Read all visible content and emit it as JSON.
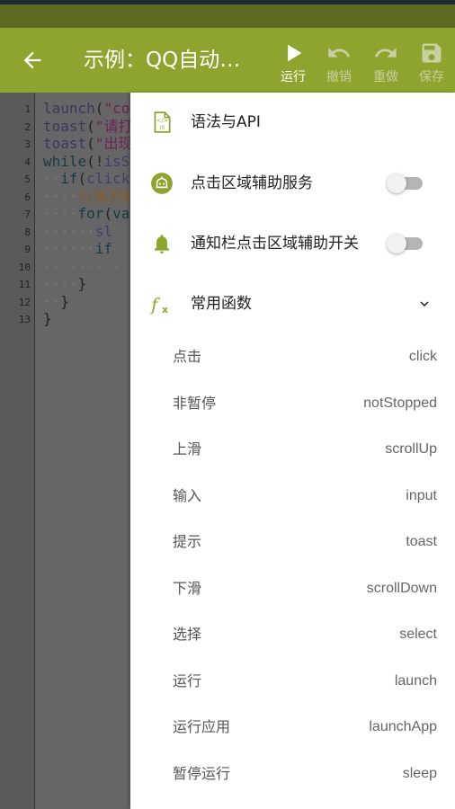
{
  "colors": {
    "appbar": "#8da52e",
    "accent": "#8da52e",
    "statusbar": "#5e6b22"
  },
  "appbar": {
    "back_icon": "arrow-left-icon",
    "title": "示例：QQ自动…",
    "actions": [
      {
        "label": "运行",
        "icon": "play-icon",
        "enabled": true
      },
      {
        "label": "撤销",
        "icon": "undo-icon",
        "enabled": false
      },
      {
        "label": "重做",
        "icon": "redo-icon",
        "enabled": false
      },
      {
        "label": "保存",
        "icon": "save-icon",
        "enabled": false
      }
    ]
  },
  "editor": {
    "line_numbers": [
      "1",
      "2",
      "3",
      "4",
      "5",
      "6",
      "7",
      "8",
      "9",
      "10",
      "11",
      "12",
      "13"
    ],
    "lines": [
      {
        "indent": "",
        "parts": [
          [
            "fn",
            "launch"
          ],
          [
            "p",
            "("
          ],
          [
            "str",
            "\"co"
          ]
        ]
      },
      {
        "indent": "",
        "parts": [
          [
            "fn",
            "toast"
          ],
          [
            "p",
            "("
          ],
          [
            "str",
            "\"请打"
          ]
        ]
      },
      {
        "indent": "",
        "parts": [
          [
            "fn",
            "toast"
          ],
          [
            "p",
            "("
          ],
          [
            "str",
            "\"出现"
          ]
        ]
      },
      {
        "indent": "",
        "parts": [
          [
            "kw",
            "while"
          ],
          [
            "p",
            "(!"
          ],
          [
            "id",
            "isS"
          ]
        ]
      },
      {
        "indent": "··",
        "parts": [
          [
            "kw",
            "if"
          ],
          [
            "p",
            "("
          ],
          [
            "id",
            "click"
          ]
        ]
      },
      {
        "indent": "····",
        "parts": [
          [
            "cm",
            "//拆开红"
          ]
        ]
      },
      {
        "indent": "····",
        "parts": [
          [
            "kw",
            "for"
          ],
          [
            "p",
            "("
          ],
          [
            "kw",
            "va"
          ]
        ]
      },
      {
        "indent": "······",
        "parts": [
          [
            "id",
            "sl"
          ]
        ]
      },
      {
        "indent": "······",
        "parts": [
          [
            "kw",
            "if"
          ]
        ]
      },
      {
        "indent": "·········",
        "parts": []
      },
      {
        "indent": "····",
        "parts": [
          [
            "p",
            "}"
          ]
        ]
      },
      {
        "indent": "··",
        "parts": [
          [
            "p",
            "}"
          ]
        ]
      },
      {
        "indent": "",
        "parts": [
          [
            "p",
            "}"
          ]
        ]
      }
    ]
  },
  "drawer": {
    "items": [
      {
        "label": "语法与API",
        "icon": "js-file-icon"
      },
      {
        "label": "点击区域辅助服务",
        "icon": "robot-icon",
        "toggle": false
      },
      {
        "label": "通知栏点击区域辅助开关",
        "icon": "bell-icon",
        "toggle": false
      },
      {
        "label": "常用函数",
        "icon": "function-icon",
        "expanded": true
      }
    ],
    "functions": [
      {
        "cn": "点击",
        "en": "click"
      },
      {
        "cn": "非暂停",
        "en": "notStopped"
      },
      {
        "cn": "上滑",
        "en": "scrollUp"
      },
      {
        "cn": "输入",
        "en": "input"
      },
      {
        "cn": "提示",
        "en": "toast"
      },
      {
        "cn": "下滑",
        "en": "scrollDown"
      },
      {
        "cn": "选择",
        "en": "select"
      },
      {
        "cn": "运行",
        "en": "launch"
      },
      {
        "cn": "运行应用",
        "en": "launchApp"
      },
      {
        "cn": "暂停运行",
        "en": "sleep"
      }
    ]
  }
}
